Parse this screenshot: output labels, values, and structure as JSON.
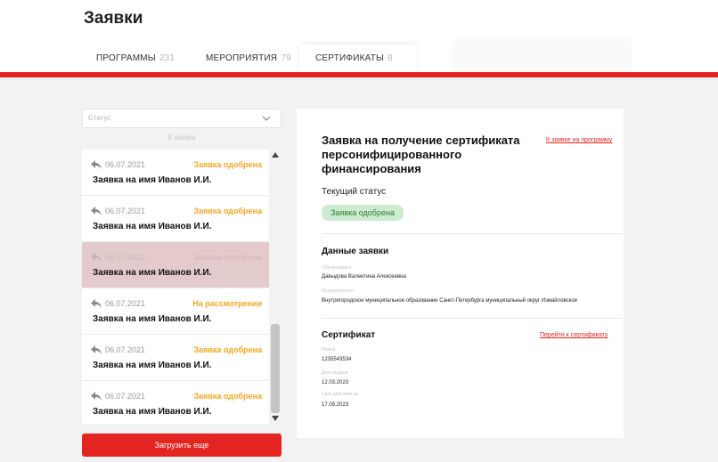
{
  "header": {
    "title": "Заявки",
    "tabs": [
      {
        "label": "ПРОГРАММЫ",
        "count": "231"
      },
      {
        "label": "МЕРОПРИЯТИЯ",
        "count": "79"
      },
      {
        "label": "СЕРТИФИКАТЫ",
        "count": "8"
      }
    ]
  },
  "filter": {
    "status_placeholder": "Статус",
    "requests_count": "8 заявок"
  },
  "requests": [
    {
      "date": "06.07.2021",
      "status": "Заявка одобрена",
      "name": "Заявка на имя Иванов И.И."
    },
    {
      "date": "06.07.2021",
      "status": "Заявка одобрена",
      "name": "Заявка на имя Иванов И.И."
    },
    {
      "date": "06.07.2021",
      "status": "Заявка одобрена",
      "name": "Заявка на имя Иванов И.И."
    },
    {
      "date": "06.07.2021",
      "status": "На рассмотрении",
      "name": "Заявка на имя Иванов И.И."
    },
    {
      "date": "06.07.2021",
      "status": "Заявка одобрена",
      "name": "Заявка на имя Иванов И.И."
    },
    {
      "date": "06.07.2021",
      "status": "Заявка одобрена",
      "name": "Заявка на имя Иванов И.И."
    }
  ],
  "load_more_label": "Загрузить еще",
  "detail": {
    "title": "Заявка на получение сертификата персонифицированного финансирования",
    "back_link": "К заявке на программу",
    "current_status_label": "Текущий статус",
    "current_status": "Заявка одобрена",
    "application": {
      "title": "Данные заявки",
      "student_label": "Обучающийся",
      "student": "Давыдова Валентина Алексеевна",
      "municipality_label": "Муниципалитет",
      "municipality": "Внутригородское муниципальное образование Санкт-Петербурга муниципальный округ Измайловское"
    },
    "certificate": {
      "title": "Сертификат",
      "link": "Перейти к сертификату",
      "number_label": "Номер",
      "number": "1235543534",
      "issue_label": "Дата выдачи",
      "issue_date": "12.03.2023",
      "valid_label": "Срок действия до",
      "valid_until": "17.09.2023"
    }
  },
  "colors": {
    "accent": "#e32421",
    "approved": "#f5a623",
    "status_pill_bg": "#cdebd0",
    "selected_row": "#e4cbcb"
  },
  "icons": {
    "reply": "reply-arrow-icon",
    "select": "chevron-down-icon"
  }
}
